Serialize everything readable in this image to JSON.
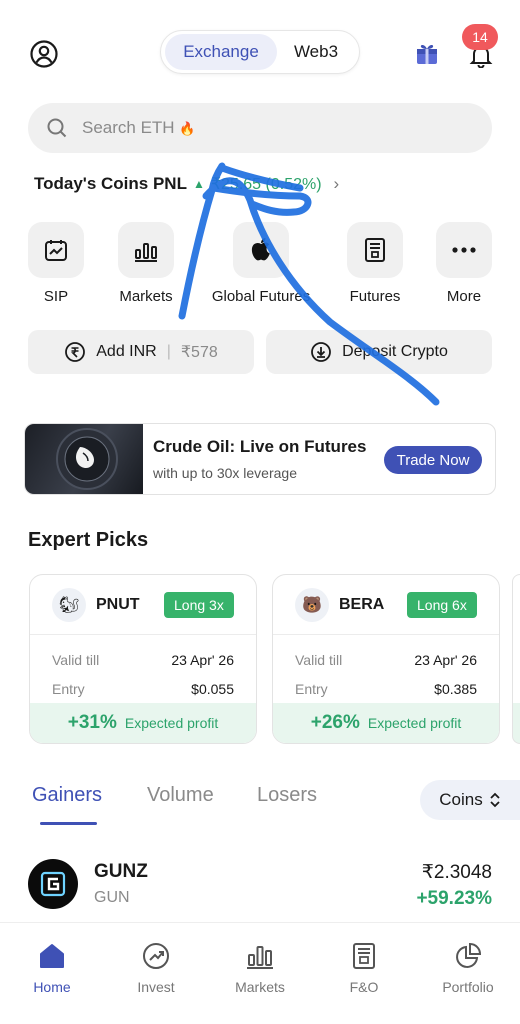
{
  "header": {
    "segments": {
      "active": "Exchange",
      "other": "Web3"
    },
    "notification_count": "14"
  },
  "search": {
    "placeholder": "Search ETH",
    "emoji": "🔥"
  },
  "pnl": {
    "label": "Today's Coins PNL",
    "value": "₹25.65 (0.52%)",
    "arrow": "▲",
    "chevron": "›"
  },
  "quick_actions": [
    {
      "label": "SIP",
      "icon": "sip-icon"
    },
    {
      "label": "Markets",
      "icon": "markets-chart-icon"
    },
    {
      "label": "Global Futures",
      "icon": "apple-icon"
    },
    {
      "label": "Futures",
      "icon": "futures-doc-icon"
    },
    {
      "label": "More",
      "icon": "more-dots-icon"
    }
  ],
  "wallet_actions": {
    "add_inr": {
      "label": "Add INR",
      "amount": "₹578",
      "sep": "|"
    },
    "deposit": {
      "label": "Deposit Crypto"
    }
  },
  "banner": {
    "title": "Crude Oil: Live on Futures",
    "subtitle": "with up to 30x leverage",
    "cta": "Trade Now"
  },
  "expert_picks": {
    "title": "Expert Picks",
    "cards": [
      {
        "coin": "PNUT",
        "leverage": "Long 3x",
        "valid_label": "Valid till",
        "valid": "23 Apr' 26",
        "entry_label": "Entry",
        "entry": "$0.055",
        "profit": "+31%",
        "profit_label": "Expected profit"
      },
      {
        "coin": "BERA",
        "leverage": "Long 6x",
        "valid_label": "Valid till",
        "valid": "23 Apr' 26",
        "entry_label": "Entry",
        "entry": "$0.385",
        "profit": "+26%",
        "profit_label": "Expected profit"
      }
    ]
  },
  "market_tabs": {
    "tabs": [
      "Gainers",
      "Volume",
      "Losers"
    ],
    "active": "Gainers",
    "selector": "Coins"
  },
  "list": [
    {
      "name": "GUNZ",
      "symbol": "GUN",
      "price": "₹2.3048",
      "change": "+59.23%"
    }
  ],
  "bottom_nav": [
    {
      "label": "Home",
      "icon": "home-icon",
      "active": true
    },
    {
      "label": "Invest",
      "icon": "invest-icon"
    },
    {
      "label": "Markets",
      "icon": "markets-icon"
    },
    {
      "label": "F&O",
      "icon": "fno-icon"
    },
    {
      "label": "Portfolio",
      "icon": "portfolio-icon"
    }
  ],
  "colors": {
    "accent": "#3f51b5",
    "positive": "#2ca36b",
    "badge": "#f0595c",
    "annotation": "#1f6fe0"
  }
}
